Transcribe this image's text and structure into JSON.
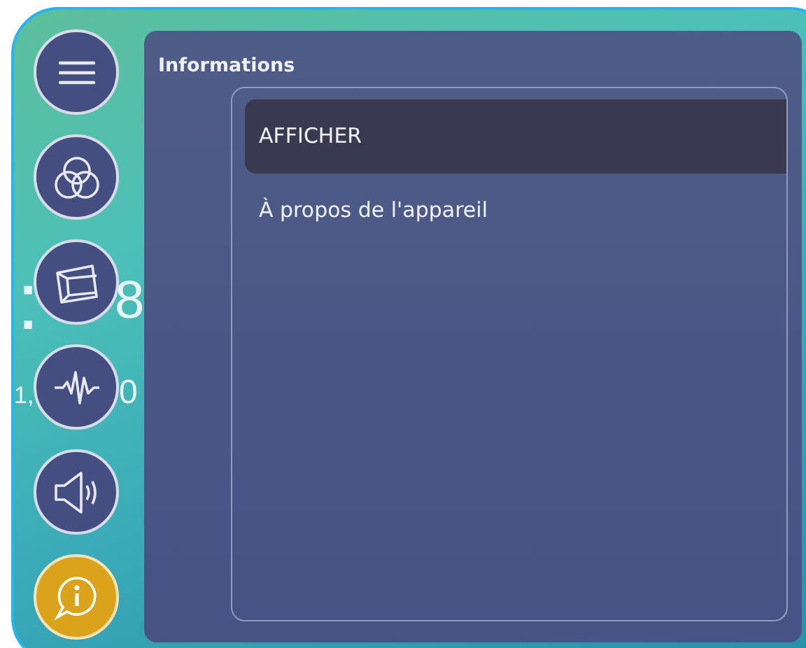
{
  "wallpaper": {
    "clock_parts": [
      ":",
      "8"
    ],
    "date_parts": [
      "1,",
      "0"
    ]
  },
  "sidebar": {
    "items": [
      {
        "kind": "menu",
        "selected": false
      },
      {
        "kind": "color",
        "selected": false
      },
      {
        "kind": "display",
        "selected": false
      },
      {
        "kind": "audio",
        "selected": false
      },
      {
        "kind": "speaker",
        "selected": false
      },
      {
        "kind": "info",
        "selected": true
      }
    ]
  },
  "panel": {
    "title": "Informations",
    "items": [
      {
        "label": "AFFICHER",
        "selected": true
      },
      {
        "label": "À propos de l'appareil",
        "selected": false
      }
    ]
  }
}
